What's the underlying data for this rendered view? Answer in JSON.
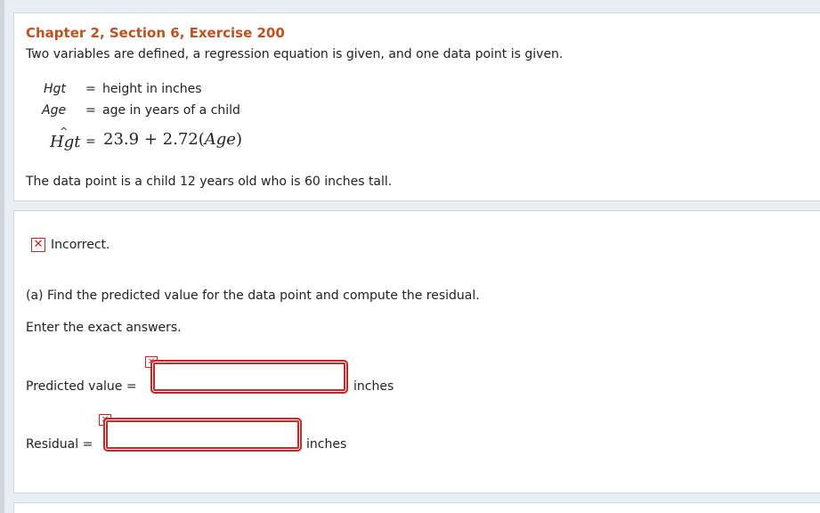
{
  "exercise": {
    "title": "Chapter 2, Section 6, Exercise 200",
    "intro": "Two variables are defined, a regression equation is given, and one data point is given."
  },
  "definitions": [
    {
      "var": "Hgt",
      "eq": "=",
      "text": "height in inches"
    },
    {
      "var": "Age",
      "eq": "=",
      "text": "age in years of a child"
    }
  ],
  "regression": {
    "hat_var": "Hgt",
    "hat_symbol": "^",
    "eq": "=",
    "intercept": "23.9",
    "plus": "+",
    "slope": "2.72",
    "predictor": "Age"
  },
  "data_point_text": "The data point is a child 12 years old who is 60 inches tall.",
  "status": {
    "icon": "x-mark-icon",
    "label": "Incorrect.",
    "color": "#cc2222"
  },
  "question": {
    "text": "(a) Find the predicted value for the data point and compute the residual.",
    "instructions": "Enter the exact answers."
  },
  "answers": {
    "predicted": {
      "label": "Predicted value =",
      "value": "",
      "unit": "inches",
      "status": "incorrect"
    },
    "residual": {
      "label": "Residual =",
      "value": "",
      "unit": "inches",
      "status": "incorrect"
    }
  },
  "colors": {
    "title": "#c0501e",
    "error": "#c62828",
    "background": "#e9eef2"
  }
}
